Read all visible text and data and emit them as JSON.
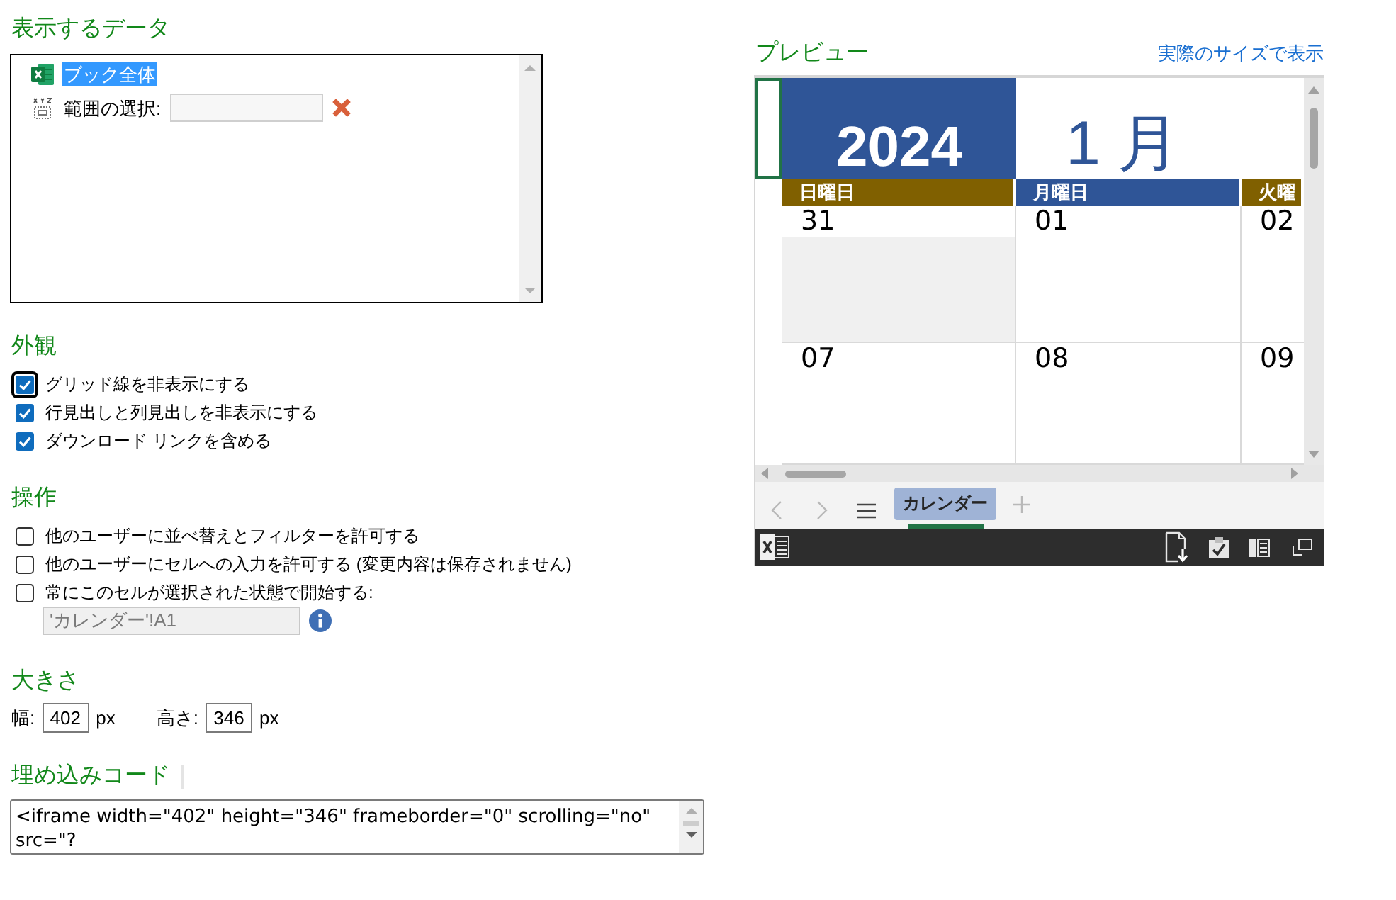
{
  "data_to_show": {
    "title": "表示するデータ",
    "items": [
      {
        "kind": "workbook",
        "label": "ブック全体",
        "selected": true
      },
      {
        "kind": "range",
        "label": "範囲の選択:",
        "selected": false
      }
    ]
  },
  "appearance": {
    "title": "外観",
    "options": [
      {
        "label": "グリッド線を非表示にする",
        "checked": true,
        "focused": true
      },
      {
        "label": "行見出しと列見出しを非表示にする",
        "checked": true,
        "focused": false
      },
      {
        "label": "ダウンロード リンクを含める",
        "checked": true,
        "focused": false
      }
    ]
  },
  "interaction": {
    "title": "操作",
    "options": [
      {
        "label": "他のユーザーに並べ替えとフィルターを許可する",
        "checked": false,
        "focused": false
      },
      {
        "label": "他のユーザーにセルへの入力を許可する (変更内容は保存されません)",
        "checked": false,
        "focused": false
      },
      {
        "label": "常にこのセルが選択された状態で開始する:",
        "checked": false,
        "focused": false
      }
    ],
    "start_cell": {
      "value": "'カレンダー'!A1",
      "disabled": true
    }
  },
  "size": {
    "title": "大きさ",
    "fields": [
      {
        "label": "幅:",
        "value": "402",
        "unit": "px"
      },
      {
        "label": "高さ:",
        "value": "346",
        "unit": "px"
      }
    ]
  },
  "embed_code": {
    "title": "埋め込みコード",
    "value": "<iframe width=\"402\" height=\"346\" frameborder=\"0\" scrolling=\"no\" src=\"?"
  },
  "preview": {
    "title": "プレビュー",
    "link": "実際のサイズで表示",
    "sheet": {
      "year": "2024",
      "month": "1 月",
      "days": [
        {
          "label": "日曜日",
          "color": "#806000"
        },
        {
          "label": "月曜日",
          "color": "#2f5597"
        },
        {
          "label": "火曜",
          "color": "#806000"
        }
      ],
      "weeks": [
        [
          {
            "date": "31",
            "other_month": true
          },
          {
            "date": "01",
            "other_month": false
          },
          {
            "date": "02",
            "other_month": false
          }
        ],
        [
          {
            "date": "07",
            "other_month": false
          },
          {
            "date": "08",
            "other_month": false
          },
          {
            "date": "09",
            "other_month": false
          }
        ]
      ],
      "tabs": [
        {
          "label": "カレンダー",
          "selected": true
        }
      ]
    }
  }
}
